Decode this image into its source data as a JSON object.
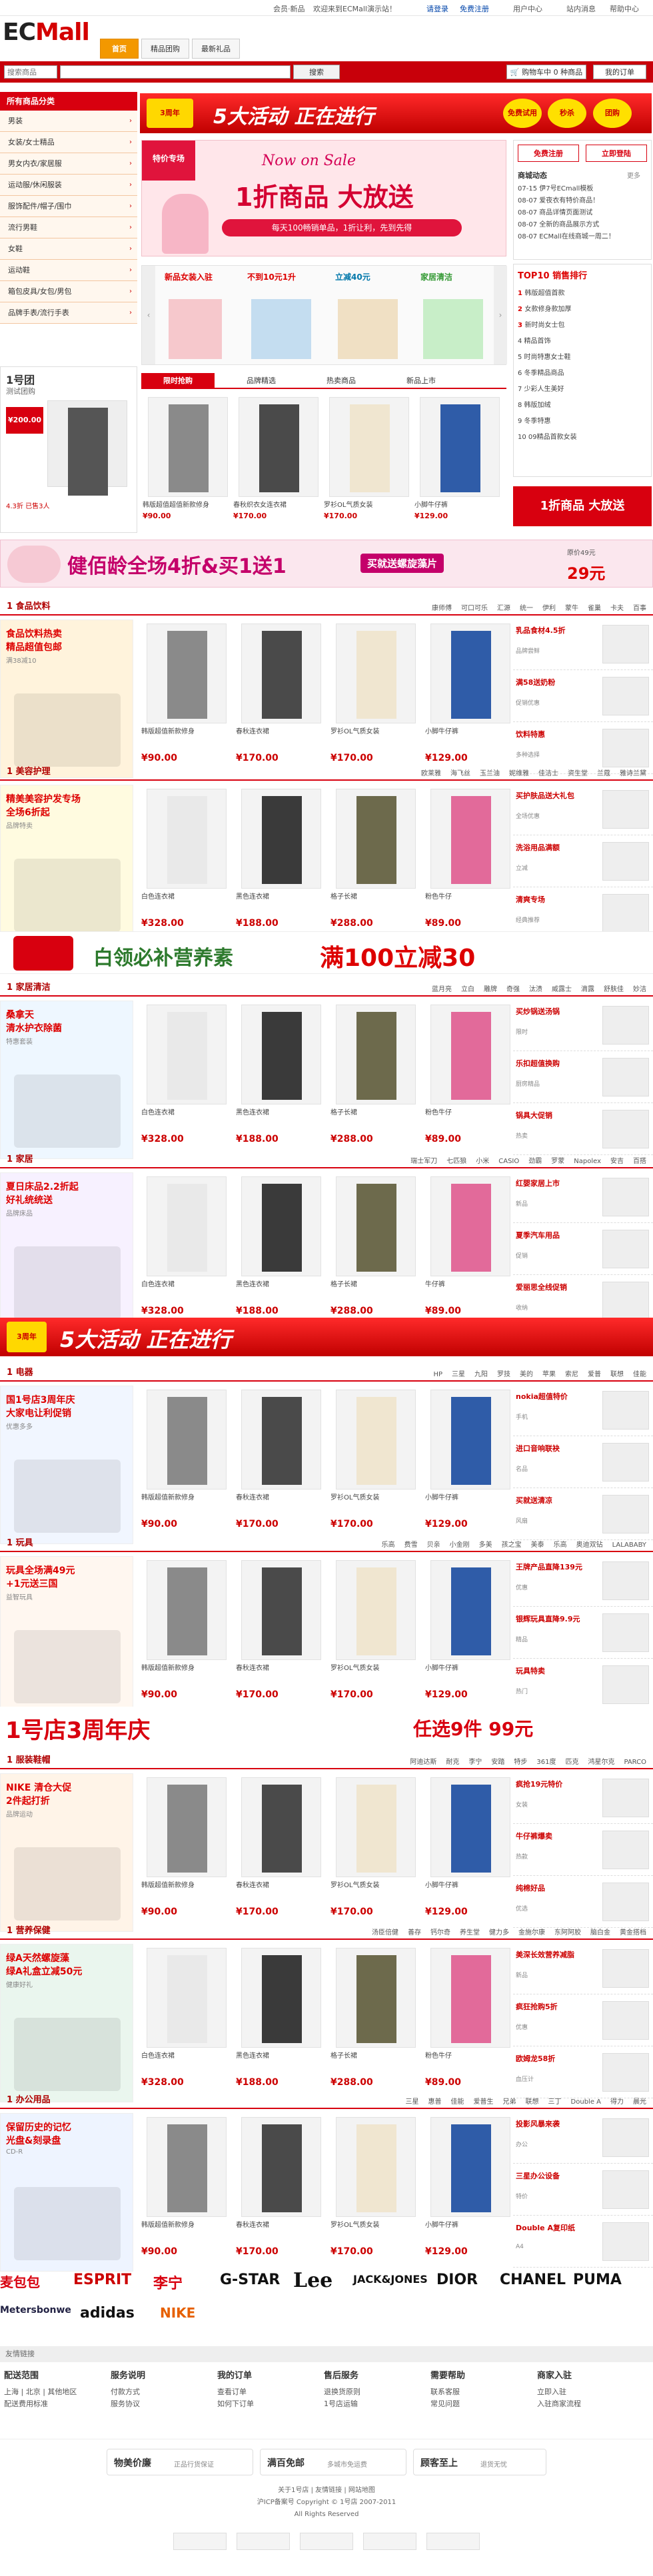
{
  "topbar": {
    "left_links": "会员·新品",
    "welcome": "欢迎来到ECMall演示站！",
    "login": "请登录",
    "register": "免费注册",
    "user_center": "用户中心",
    "sitemap": "站内消息",
    "help": "帮助中心"
  },
  "logo": {
    "ec": "EC",
    "mall": "Mall"
  },
  "nav": {
    "tabs": [
      {
        "label": "首页"
      },
      {
        "label": "精品团购"
      },
      {
        "label": "最新礼品"
      }
    ]
  },
  "search": {
    "category_placeholder": "搜索商品",
    "button": "搜索",
    "cart_count": "购物车中 0 种商品",
    "checkout": "去结算",
    "favorites": "我的订单"
  },
  "sidebar": {
    "title": "所有商品分类",
    "items": [
      {
        "label": "男装"
      },
      {
        "label": "女装/女士精品"
      },
      {
        "label": "男女内衣/家居服"
      },
      {
        "label": "运动服/休闲服装"
      },
      {
        "label": "服饰配件/帽子/围巾"
      },
      {
        "label": "流行男鞋"
      },
      {
        "label": "女鞋"
      },
      {
        "label": "运动鞋"
      },
      {
        "label": "箱包皮具/女包/男包"
      },
      {
        "label": "品牌手表/流行手表"
      }
    ]
  },
  "top_banner": {
    "text": "5大活动 正在进行",
    "badge1": "免费试用",
    "badge2": "秒杀",
    "badge3": "团购"
  },
  "main_banner": {
    "top": "Now on Sale",
    "title": "1折商品 大放送",
    "sub": "每天100畅销单品，1折让利，先到先得",
    "tag": "特价专场"
  },
  "right_box": {
    "btn1": "免费注册",
    "btn2": "立即登陆",
    "news_title": "商城动态",
    "news_more": "更多",
    "news": [
      "07-15 伊7号ECmall模板",
      "08-07 爱夜衣有特价商品！",
      "08-07 商品详情页面测试",
      "08-07 全新的商品展示方式",
      "08-07 ECMall在线商城一周二！"
    ],
    "top_title": "TOP10 销售排行",
    "top_list": [
      "韩版超值首款",
      "女款修身款加厚",
      "新时尚女士包",
      "精品首饰",
      "时尚特惠女士鞋",
      "冬季精品商品",
      "少彩人生美好",
      "韩版加绒",
      "冬季特惠",
      "09精品首款女装"
    ]
  },
  "mini_tabs": {
    "tabs": [
      {
        "label": "新品女装入驻"
      },
      {
        "label": "不到10元1升"
      },
      {
        "label": "立减40元"
      },
      {
        "label": "家居清洁"
      }
    ]
  },
  "feature_tabs": {
    "tabs": [
      {
        "label": "限时抢购"
      },
      {
        "label": "品牌精选"
      },
      {
        "label": "热卖商品"
      },
      {
        "label": "新品上市"
      }
    ]
  },
  "feature_items": [
    {
      "name": "韩版超值超值新款修身",
      "price": "¥90.00"
    },
    {
      "name": "春秋织衣女连衣裙",
      "price": "¥170.00"
    },
    {
      "name": "罗衫OL气质女装",
      "price": "¥170.00"
    },
    {
      "name": "小脚牛仔裤",
      "price": "¥129.00"
    }
  ],
  "group": {
    "title": "1号团",
    "subtitle": "测试团购",
    "price": "¥200.00",
    "stats": "4.3折  已售3人"
  },
  "wide_banner": {
    "text": "健佰龄全场4折&买1送1",
    "right": "买就送螺旋藻片",
    "right_sub": "原价49元",
    "price": "29元"
  },
  "sections": [
    {
      "title": "1 食品饮料",
      "brands": [
        "康师傅",
        "可口可乐",
        "汇源",
        "统一",
        "伊利",
        "蒙牛",
        "雀巢",
        "卡夫",
        "百事"
      ],
      "promo": {
        "l1": "食品饮料热卖",
        "l2": "精品超值包邮",
        "l3": "满38减10"
      },
      "products": [
        {
          "name": "韩版超值新款修身",
          "price": "¥90.00"
        },
        {
          "name": "春秋连衣裙",
          "price": "¥170.00"
        },
        {
          "name": "罗衫OL气质女装",
          "price": "¥170.00"
        },
        {
          "name": "小脚牛仔裤",
          "price": "¥129.00"
        }
      ],
      "side": [
        {
          "t": "乳品食材4.5折",
          "s": "品牌尝鲜"
        },
        {
          "t": "满58送奶粉",
          "s": "促销优惠"
        },
        {
          "t": "饮料特惠",
          "s": "多种选择"
        }
      ]
    },
    {
      "title": "1 美容护理",
      "brands": [
        "欧莱雅",
        "海飞丝",
        "玉兰油",
        "妮维雅",
        "佳洁士",
        "资生堂",
        "兰蔻",
        "雅诗兰黛"
      ],
      "promo": {
        "l1": "精美美容护发专场",
        "l2": "全场6折起",
        "l3": "品牌特卖"
      },
      "products": [
        {
          "name": "白色连衣裙",
          "price": "¥328.00"
        },
        {
          "name": "黑色连衣裙",
          "price": "¥188.00"
        },
        {
          "name": "格子长裙",
          "price": "¥288.00"
        },
        {
          "name": "粉色牛仔",
          "price": "¥89.00"
        }
      ],
      "side": [
        {
          "t": "买护肤品送大礼包",
          "s": "全场优惠"
        },
        {
          "t": "洗浴用品满额",
          "s": "立减"
        },
        {
          "t": "清爽专场",
          "s": "经典推荐"
        }
      ]
    },
    {
      "title": "1 家居清洁",
      "brands": [
        "蓝月亮",
        "立白",
        "雕牌",
        "奇强",
        "汰渍",
        "威露士",
        "滴露",
        "舒肤佳",
        "妙洁"
      ],
      "promo": {
        "l1": "桑拿天",
        "l2": "清水护衣除菌",
        "l3": "特惠套装"
      },
      "products": [
        {
          "name": "白色连衣裙",
          "price": "¥328.00"
        },
        {
          "name": "黑色连衣裙",
          "price": "¥188.00"
        },
        {
          "name": "格子长裙",
          "price": "¥288.00"
        },
        {
          "name": "粉色牛仔",
          "price": "¥89.00"
        }
      ],
      "side": [
        {
          "t": "买炒锅送汤锅",
          "s": "限时"
        },
        {
          "t": "乐扣超值换购",
          "s": "厨房精品"
        },
        {
          "t": "锅具大促销",
          "s": "热卖"
        }
      ]
    },
    {
      "title": "1 家居",
      "brands": [
        "瑞士军刀",
        "七匹狼",
        "小米",
        "CASIO",
        "劲霸",
        "罗蒙",
        "Napolex",
        "安吉",
        "百搭"
      ],
      "promo": {
        "l1": "夏日床品2.2折起",
        "l2": "好礼统统送",
        "l3": "品牌床品"
      },
      "products": [
        {
          "name": "白色连衣裙",
          "price": "¥328.00"
        },
        {
          "name": "黑色连衣裙",
          "price": "¥188.00"
        },
        {
          "name": "格子长裙",
          "price": "¥288.00"
        },
        {
          "name": "牛仔裤",
          "price": "¥89.00"
        }
      ],
      "side": [
        {
          "t": "红婴家居上市",
          "s": "新品"
        },
        {
          "t": "夏季汽车用品",
          "s": "促销"
        },
        {
          "t": "爱丽思全线促销",
          "s": "收纳"
        }
      ]
    },
    {
      "title": "1 电器",
      "brands": [
        "HP",
        "三星",
        "九阳",
        "罗技",
        "美的",
        "苹果",
        "索尼",
        "爱普",
        "联想",
        "佳能"
      ],
      "promo": {
        "l1": "国1号店3周年庆",
        "l2": "大家电让利促销",
        "l3": "优惠多多"
      },
      "products": [
        {
          "name": "韩版超值新款修身",
          "price": "¥90.00"
        },
        {
          "name": "春秋连衣裙",
          "price": "¥170.00"
        },
        {
          "name": "罗衫OL气质女装",
          "price": "¥170.00"
        },
        {
          "name": "小脚牛仔裤",
          "price": "¥129.00"
        }
      ],
      "side": [
        {
          "t": "nokia超值特价",
          "s": "手机"
        },
        {
          "t": "进口音响联袂",
          "s": "名品"
        },
        {
          "t": "买就送清凉",
          "s": "风扇"
        }
      ]
    },
    {
      "title": "1 玩具",
      "brands": [
        "乐高",
        "费雪",
        "贝亲",
        "小金刚",
        "多美",
        "孩之宝",
        "美泰",
        "乐高",
        "奥迪双钻",
        "LALABABY"
      ],
      "promo": {
        "l1": "玩具全场满49元",
        "l2": "+1元送三国",
        "l3": "益智玩具"
      },
      "products": [
        {
          "name": "韩版超值新款修身",
          "price": "¥90.00"
        },
        {
          "name": "春秋连衣裙",
          "price": "¥170.00"
        },
        {
          "name": "罗衫OL气质女装",
          "price": "¥170.00"
        },
        {
          "name": "小脚牛仔裤",
          "price": "¥129.00"
        }
      ],
      "side": [
        {
          "t": "王牌产品直降139元",
          "s": "优惠"
        },
        {
          "t": "银辉玩具直降9.9元",
          "s": "精品"
        },
        {
          "t": "玩具特卖",
          "s": "热门"
        }
      ]
    },
    {
      "title": "1 服装鞋帽",
      "brands": [
        "阿迪达斯",
        "耐克",
        "李宁",
        "安踏",
        "特步",
        "361度",
        "匹克",
        "鸿星尔克",
        "PARCO"
      ],
      "promo": {
        "l1": "NIKE 清仓大促",
        "l2": "2件起打折",
        "l3": "品牌运动"
      },
      "products": [
        {
          "name": "韩版超值新款修身",
          "price": "¥90.00"
        },
        {
          "name": "春秋连衣裙",
          "price": "¥170.00"
        },
        {
          "name": "罗衫OL气质女装",
          "price": "¥170.00"
        },
        {
          "name": "小脚牛仔裤",
          "price": "¥129.00"
        }
      ],
      "side": [
        {
          "t": "疯抢19元特价",
          "s": "女装"
        },
        {
          "t": "牛仔裤爆卖",
          "s": "热款"
        },
        {
          "t": "纯棉好品",
          "s": "优选"
        }
      ]
    },
    {
      "title": "1 营养保健",
      "brands": [
        "汤臣倍健",
        "善存",
        "钙尔奇",
        "养生堂",
        "健力多",
        "金施尔康",
        "东阿阿胶",
        "脑白金",
        "黄金搭档"
      ],
      "promo": {
        "l1": "绿A天然螺旋藻",
        "l2": "绿A礼盒立减50元",
        "l3": "健康好礼"
      },
      "products": [
        {
          "name": "白色连衣裙",
          "price": "¥328.00"
        },
        {
          "name": "黑色连衣裙",
          "price": "¥188.00"
        },
        {
          "name": "格子长裙",
          "price": "¥288.00"
        },
        {
          "name": "粉色牛仔",
          "price": "¥89.00"
        }
      ],
      "side": [
        {
          "t": "美深长效营养减脂",
          "s": "新品"
        },
        {
          "t": "疯狂抢购5折",
          "s": "优惠"
        },
        {
          "t": "欧姆龙58折",
          "s": "血压计"
        }
      ]
    },
    {
      "title": "1 办公用品",
      "brands": [
        "三星",
        "惠普",
        "佳能",
        "爱普生",
        "兄弟",
        "联想",
        "三丁",
        "Double A",
        "得力",
        "晨光"
      ],
      "promo": {
        "l1": "保留历史的记忆",
        "l2": "光盘&刻录盘",
        "l3": "CD-R"
      },
      "products": [
        {
          "name": "韩版超值新款修身",
          "price": "¥90.00"
        },
        {
          "name": "春秋连衣裙",
          "price": "¥170.00"
        },
        {
          "name": "罗衫OL气质女装",
          "price": "¥170.00"
        },
        {
          "name": "小脚牛仔裤",
          "price": "¥129.00"
        }
      ],
      "side": [
        {
          "t": "投影风暴来袭",
          "s": "办公"
        },
        {
          "t": "三星办公设备",
          "s": "特价"
        },
        {
          "t": "Double A复印纸",
          "s": "A4"
        }
      ]
    }
  ],
  "mid_banners": {
    "b1": "白领必补营养素",
    "b1_price": "满100立减30",
    "b2": "5大活动 正在进行",
    "b3": "1号店3周年庆",
    "b3_sub": "任选9件 99元"
  },
  "brands_footer": [
    "麦包包",
    "ESPRIT",
    "李宁",
    "G-STAR",
    "Lee",
    "JACK&JONES",
    "DIOR",
    "CHANEL",
    "PUMA",
    "Metersbonwe",
    "adidas",
    "NIKE"
  ],
  "links_bar": "友情链接",
  "footer": {
    "cols": [
      {
        "h": "配送范围",
        "l1": "上海 | 北京 | 其他地区",
        "l2": "配送费用标准"
      },
      {
        "h": "服务说明",
        "l1": "付款方式",
        "l2": "服务协议"
      },
      {
        "h": "我的订单",
        "l1": "查看订单",
        "l2": "如何下订单"
      },
      {
        "h": "售后服务",
        "l1": "退换货原则",
        "l2": "1号店运输"
      },
      {
        "h": "需要帮助",
        "l1": "联系客服",
        "l2": "常见问题"
      },
      {
        "h": "商家入驻",
        "l1": "立即入驻",
        "l2": "入驻商家流程"
      }
    ],
    "promos": [
      {
        "t": "物美价廉",
        "s": "正品行货保证"
      },
      {
        "t": "满百免邮",
        "s": "多城市免运费"
      },
      {
        "t": "顾客至上",
        "s": "退货无忧"
      }
    ],
    "copyright": "关于1号店 | 友情链接 | 网站地图",
    "icp": "沪ICP备案号 Copyright © 1号店 2007-2011",
    "rights": "All Rights Reserved"
  },
  "colors": {
    "brand_red": "#d8000f",
    "orange": "#f39800",
    "price_red": "#cc0000"
  }
}
